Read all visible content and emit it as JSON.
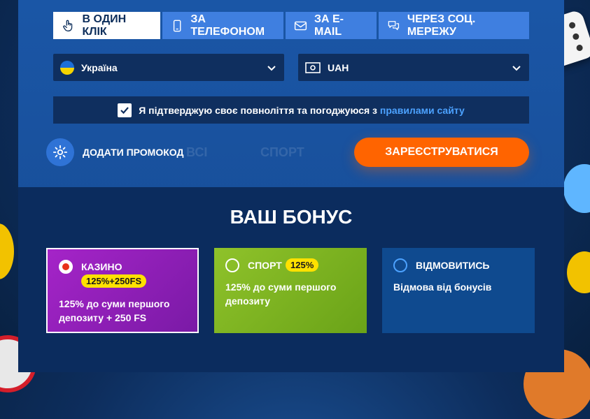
{
  "tabs": [
    {
      "label": "В ОДИН КЛІК",
      "icon": "hand-pointer-icon",
      "active": true
    },
    {
      "label": "ЗА ТЕЛЕФОНОМ",
      "icon": "phone-icon",
      "active": false
    },
    {
      "label": "ЗА E-MAIL",
      "icon": "envelope-icon",
      "active": false
    },
    {
      "label": "ЧЕРЕЗ СОЦ. МЕРЕЖУ",
      "icon": "chat-bubbles-icon",
      "active": false
    }
  ],
  "country": {
    "value": "Україна",
    "icon": "ukraine-flag-icon"
  },
  "currency": {
    "value": "UAH",
    "icon": "money-icon"
  },
  "confirm": {
    "text": "Я підтверджую своє повноліття та погоджуюся з",
    "link": "правилами сайту",
    "checked": true
  },
  "promo": {
    "label": "ДОДАТИ ПРОМОКОД"
  },
  "ghost": {
    "left": "ВСІ",
    "right": "СПОРТ"
  },
  "register": {
    "label": "ЗАРЕЄСТРУВАТИСЯ"
  },
  "bonus": {
    "title": "ВАШ БОНУС",
    "cards": [
      {
        "name": "КАЗИНО",
        "badge": "125%+250FS",
        "desc_line1": "125% до суми першого",
        "desc_line2": "депозиту + 250 FS",
        "selected": true
      },
      {
        "name": "СПОРТ",
        "badge": "125%",
        "desc_line1": "125% до суми першого",
        "desc_line2": "депозиту",
        "selected": false
      },
      {
        "name": "ВІДМОВИТИСЬ",
        "badge": "",
        "desc_line1": "Відмова від бонусів",
        "desc_line2": "",
        "selected": false
      }
    ]
  },
  "colors": {
    "accent": "#ff6400",
    "tab": "#3f7fe0",
    "casino": "#8e1fb0",
    "sport": "#7cb21f",
    "decline": "#0f4a8f",
    "badge": "#ffe100"
  }
}
